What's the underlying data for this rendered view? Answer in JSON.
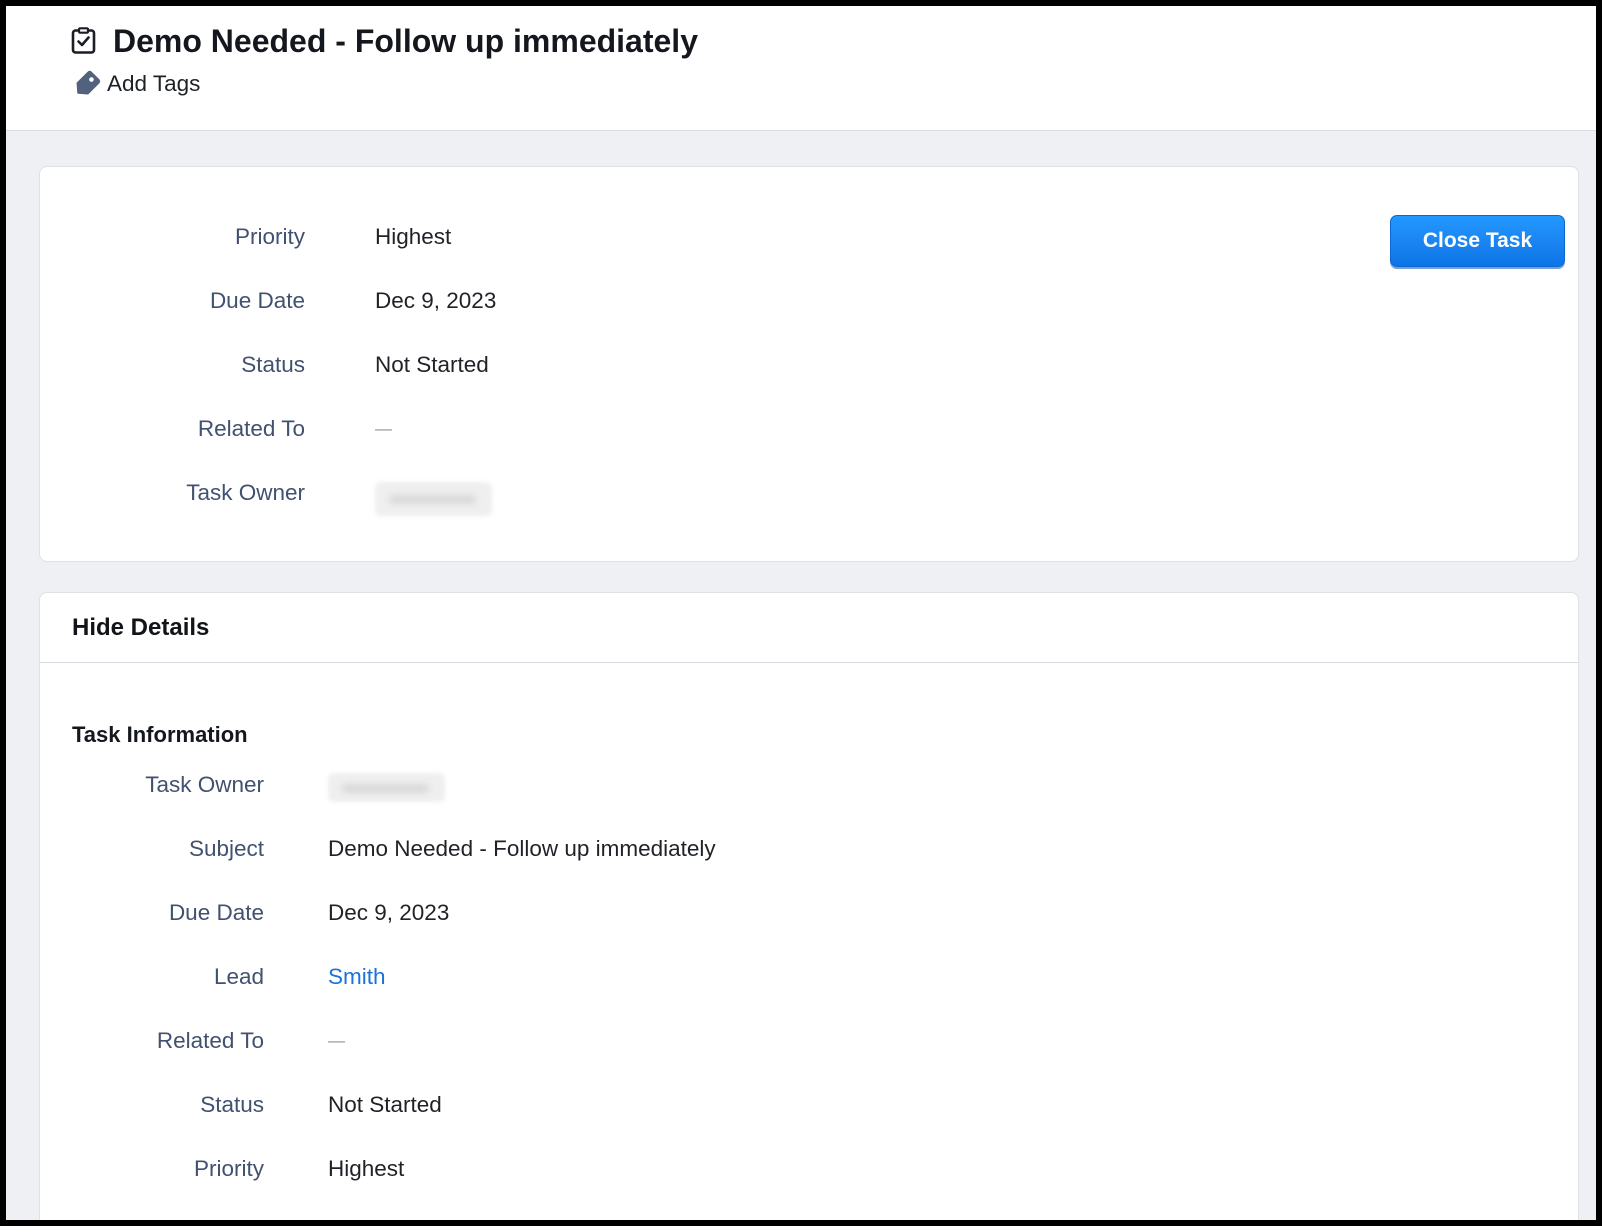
{
  "theme": {
    "accent": "#1a84f0",
    "link": "#1a73d9",
    "label": "#415170",
    "canvas": "#eef0f3"
  },
  "header": {
    "title": "Demo Needed - Follow up immediately",
    "title_icon": "task-checklist-icon",
    "add_tags": {
      "label": "Add Tags",
      "icon": "tag-icon"
    }
  },
  "summary": {
    "fields": [
      {
        "label": "Priority",
        "value": "Highest"
      },
      {
        "label": "Due Date",
        "value": "Dec 9, 2023"
      },
      {
        "label": "Status",
        "value": "Not Started"
      },
      {
        "label": "Related To",
        "value": "—"
      },
      {
        "label": "Task Owner"
      }
    ],
    "close_task_label": "Close Task"
  },
  "details": {
    "toggle_label": "Hide Details",
    "section_title": "Task Information",
    "fields": [
      {
        "label": "Task Owner"
      },
      {
        "label": "Subject",
        "value": "Demo Needed - Follow up immediately"
      },
      {
        "label": "Due Date",
        "value": "Dec 9, 2023"
      },
      {
        "label": "Lead",
        "value": "Smith"
      },
      {
        "label": "Related To",
        "value": "—"
      },
      {
        "label": "Status",
        "value": "Not Started"
      },
      {
        "label": "Priority",
        "value": "Highest"
      }
    ]
  }
}
